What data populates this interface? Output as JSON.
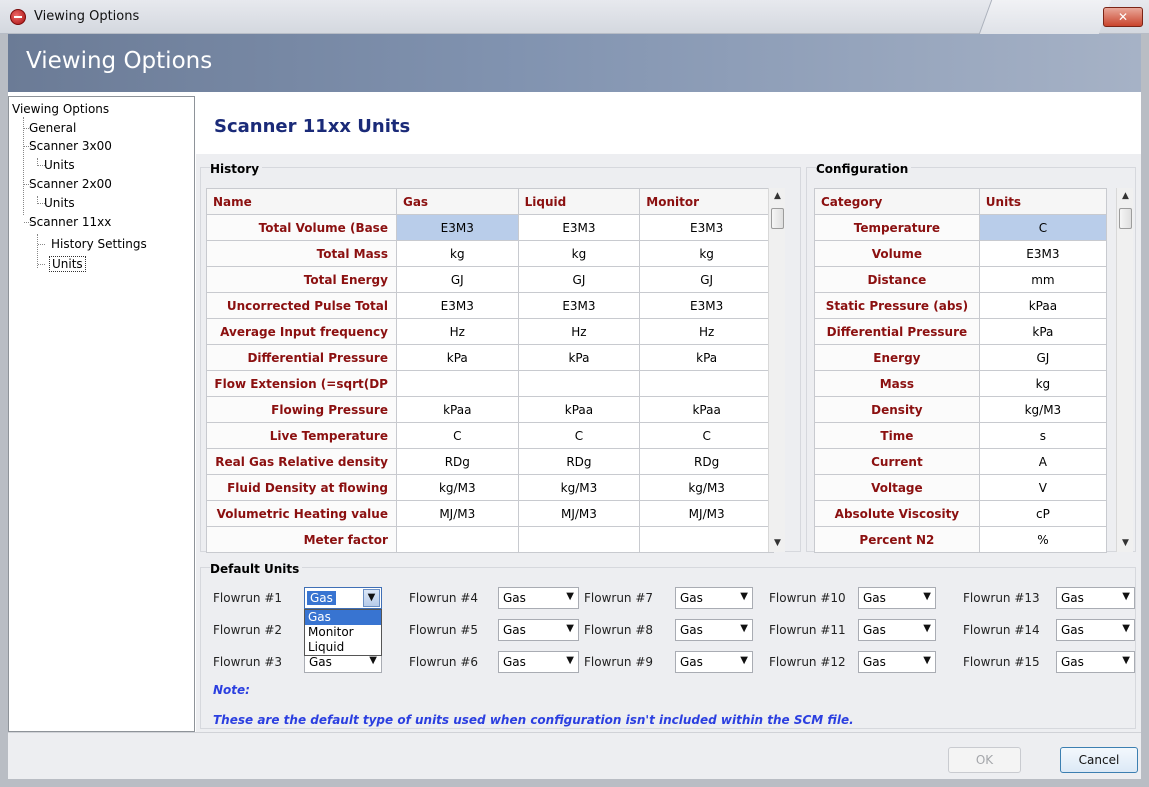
{
  "window": {
    "title": "Viewing Options",
    "close_glyph": "✕"
  },
  "banner": {
    "title": "Viewing Options"
  },
  "tree": {
    "root": "Viewing Options",
    "general": "General",
    "scanner3": "Scanner 3x00",
    "scanner3_units": "Units",
    "scanner2": "Scanner 2x00",
    "scanner2_units": "Units",
    "scanner11": "Scanner 11xx",
    "history_settings": "History Settings",
    "scanner11_units": "Units"
  },
  "content": {
    "title": "Scanner 11xx Units"
  },
  "history": {
    "title": "History",
    "headers": [
      "Name",
      "Gas",
      "Liquid",
      "Monitor"
    ],
    "rows": [
      [
        "Total Volume (Base",
        "E3M3",
        "E3M3",
        "E3M3"
      ],
      [
        "Total Mass",
        "kg",
        "kg",
        "kg"
      ],
      [
        "Total Energy",
        "GJ",
        "GJ",
        "GJ"
      ],
      [
        "Uncorrected Pulse Total",
        "E3M3",
        "E3M3",
        "E3M3"
      ],
      [
        "Average Input frequency",
        "Hz",
        "Hz",
        "Hz"
      ],
      [
        "Differential Pressure",
        "kPa",
        "kPa",
        "kPa"
      ],
      [
        "Flow Extension (=sqrt(DP",
        "",
        "",
        ""
      ],
      [
        "Flowing Pressure",
        "kPaa",
        "kPaa",
        "kPaa"
      ],
      [
        "Live Temperature",
        "C",
        "C",
        "C"
      ],
      [
        "Real Gas Relative density",
        "RDg",
        "RDg",
        "RDg"
      ],
      [
        "Fluid Density at flowing",
        "kg/M3",
        "kg/M3",
        "kg/M3"
      ],
      [
        "Volumetric Heating value",
        "MJ/M3",
        "MJ/M3",
        "MJ/M3"
      ],
      [
        "Meter factor",
        "",
        "",
        ""
      ]
    ]
  },
  "configuration": {
    "title": "Configuration",
    "headers": [
      "Category",
      "Units"
    ],
    "rows": [
      [
        "Temperature",
        "C"
      ],
      [
        "Volume",
        "E3M3"
      ],
      [
        "Distance",
        "mm"
      ],
      [
        "Static Pressure (abs)",
        "kPaa"
      ],
      [
        "Differential Pressure",
        "kPa"
      ],
      [
        "Energy",
        "GJ"
      ],
      [
        "Mass",
        "kg"
      ],
      [
        "Density",
        "kg/M3"
      ],
      [
        "Time",
        "s"
      ],
      [
        "Current",
        "A"
      ],
      [
        "Voltage",
        "V"
      ],
      [
        "Absolute Viscosity",
        "cP"
      ],
      [
        "Percent N2",
        "%"
      ]
    ]
  },
  "default_units": {
    "title": "Default Units",
    "flowruns": [
      {
        "label": "Flowrun #1",
        "value": "Gas"
      },
      {
        "label": "Flowrun #2",
        "value": ""
      },
      {
        "label": "Flowrun #3",
        "value": "Gas"
      },
      {
        "label": "Flowrun #4",
        "value": "Gas"
      },
      {
        "label": "Flowrun #5",
        "value": "Gas"
      },
      {
        "label": "Flowrun #6",
        "value": "Gas"
      },
      {
        "label": "Flowrun #7",
        "value": "Gas"
      },
      {
        "label": "Flowrun #8",
        "value": "Gas"
      },
      {
        "label": "Flowrun #9",
        "value": "Gas"
      },
      {
        "label": "Flowrun #10",
        "value": "Gas"
      },
      {
        "label": "Flowrun #11",
        "value": "Gas"
      },
      {
        "label": "Flowrun #12",
        "value": "Gas"
      },
      {
        "label": "Flowrun #13",
        "value": "Gas"
      },
      {
        "label": "Flowrun #14",
        "value": "Gas"
      },
      {
        "label": "Flowrun #15",
        "value": "Gas"
      }
    ],
    "dropdown_options": [
      "Gas",
      "Monitor",
      "Liquid"
    ],
    "arrow_glyph": "▼",
    "note_label": "Note:",
    "note_text": "These are the default type of units used when configuration isn't included within the SCM file."
  },
  "buttons": {
    "ok": "OK",
    "cancel": "Cancel"
  },
  "scroll": {
    "up": "▲",
    "down": "▼"
  }
}
